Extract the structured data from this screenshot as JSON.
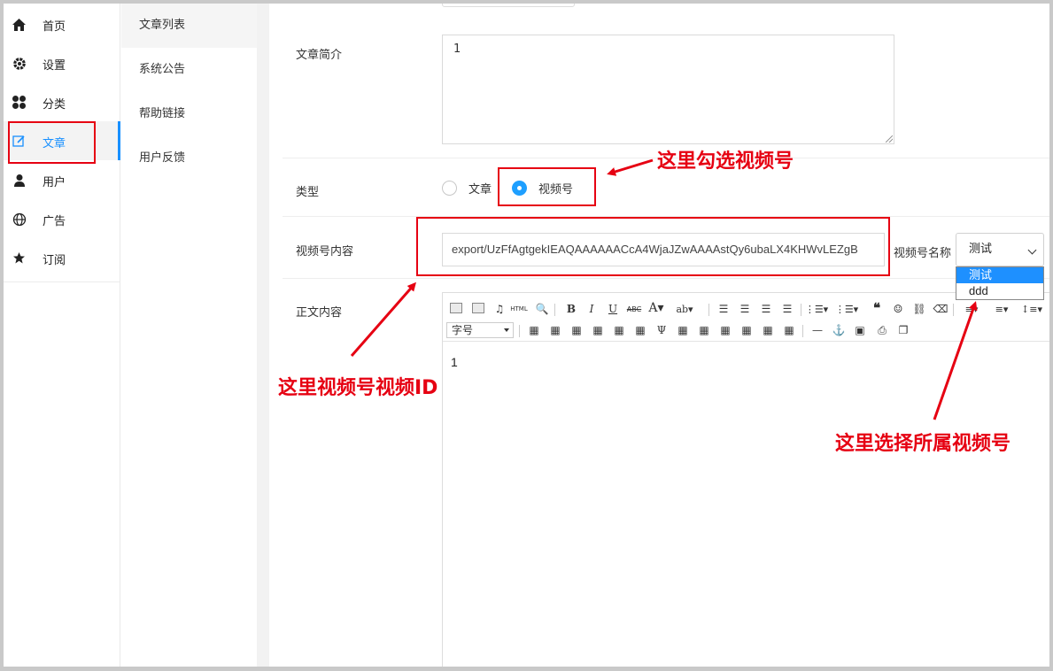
{
  "sidebar": {
    "items": [
      {
        "label": "首页",
        "icon": "home-icon"
      },
      {
        "label": "设置",
        "icon": "gear-icon"
      },
      {
        "label": "分类",
        "icon": "category-icon"
      },
      {
        "label": "文章",
        "icon": "edit-icon"
      },
      {
        "label": "用户",
        "icon": "user-icon"
      },
      {
        "label": "广告",
        "icon": "globe-icon"
      },
      {
        "label": "订阅",
        "icon": "star-icon"
      }
    ],
    "active_index": 3
  },
  "submenu": {
    "items": [
      "文章列表",
      "系统公告",
      "帮助链接",
      "用户反馈"
    ],
    "active_index": 0
  },
  "form": {
    "summary_label": "文章简介",
    "summary_value": "1",
    "type_label": "类型",
    "type_options": [
      "文章",
      "视频号"
    ],
    "type_selected": "视频号",
    "video_content_label": "视频号内容",
    "video_content_value": "export/UzFfAgtgekIEAQAAAAAACcA4WjaJZwAAAAstQy6ubaLX4KHWvLEZgB",
    "video_name_label": "视频号名称",
    "video_name_selected": "测试",
    "video_name_options": [
      "测试",
      "ddd"
    ],
    "body_label": "正文内容",
    "body_value": "1",
    "fontsize_placeholder": "字号"
  },
  "annotations": {
    "type_note": "这里勾选视频号",
    "id_note": "这里视频号视频ID",
    "account_note": "这里选择所属视频号"
  },
  "colors": {
    "accent": "#1890ff",
    "radio_checked": "#1e9fff",
    "annotation": "#e60012"
  }
}
